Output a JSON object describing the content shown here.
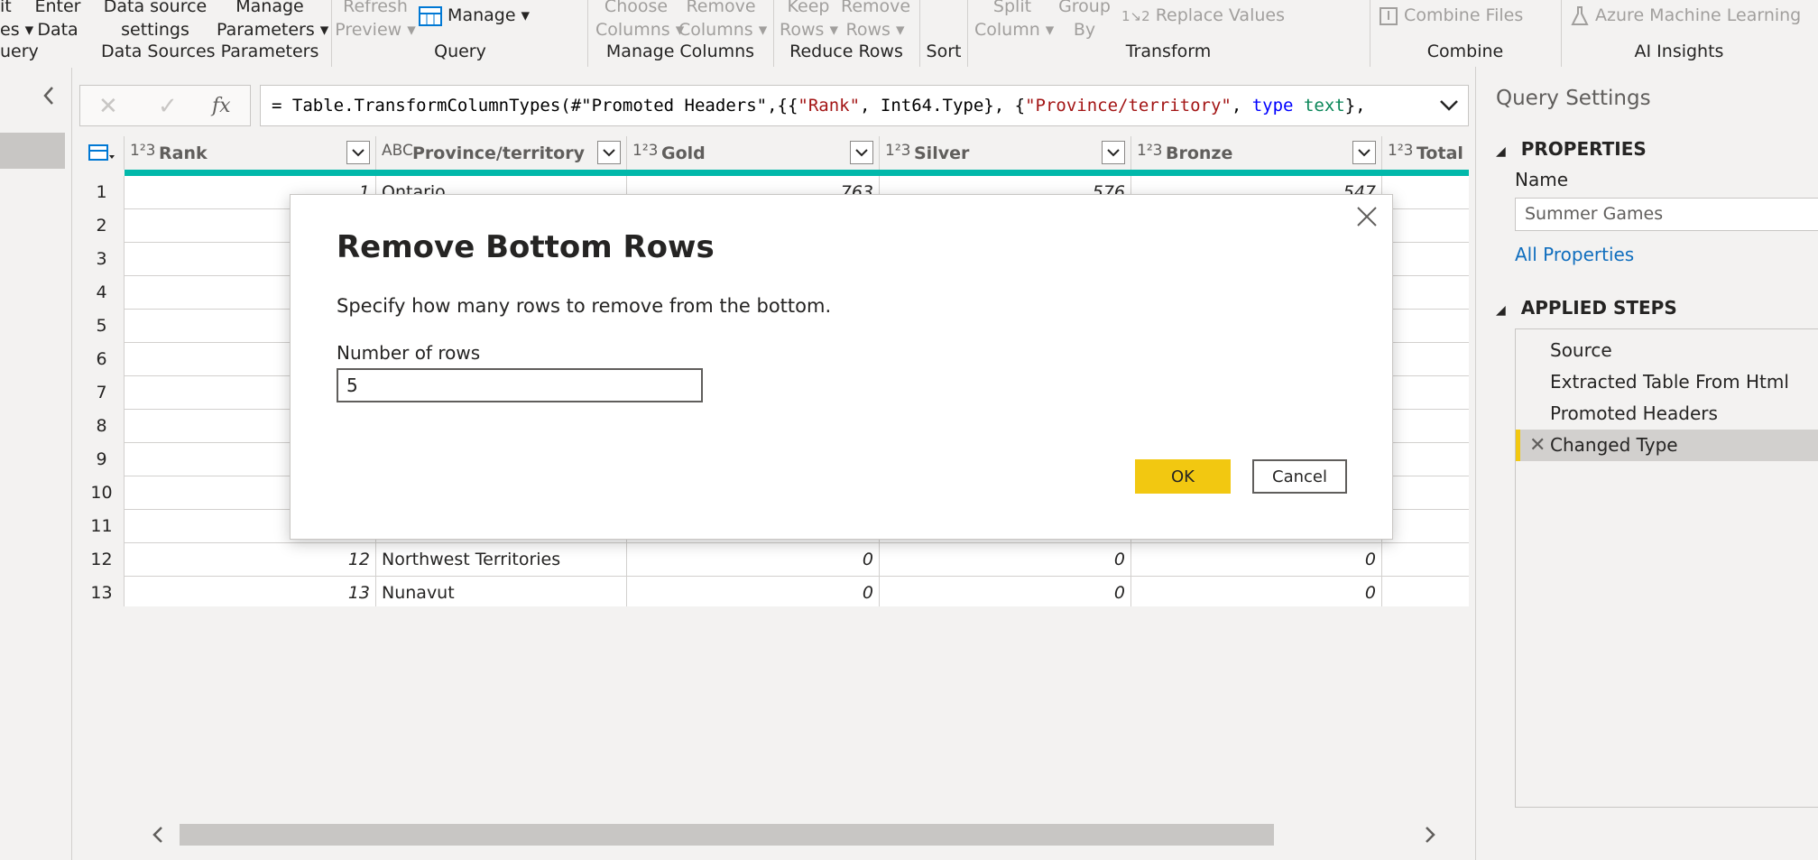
{
  "ribbon": {
    "buttons": {
      "recent_sources": "it\nes ▾",
      "enter_data": "Enter\nData",
      "data_source_settings": "Data source\nsettings",
      "manage_parameters": "Manage\nParameters ▾",
      "refresh_preview": "Refresh\nPreview ▾",
      "manage": "Manage ▾",
      "choose_columns": "Choose\nColumns ▾",
      "remove_columns": "Remove\nColumns ▾",
      "keep_rows": "Keep\nRows ▾",
      "remove_rows": "Remove\nRows ▾",
      "split_column": "Split\nColumn ▾",
      "group_by": "Group\nBy",
      "replace_values": "Replace Values",
      "combine_files": "Combine Files",
      "azure_ml": "Azure Machine Learning"
    },
    "groups": {
      "query_left": "uery",
      "data_sources": "Data Sources",
      "parameters": "Parameters",
      "query": "Query",
      "manage_columns": "Manage Columns",
      "reduce_rows": "Reduce Rows",
      "sort": "Sort",
      "transform": "Transform",
      "combine": "Combine",
      "ai_insights": "AI Insights"
    }
  },
  "formula_bar": {
    "cancel_glyph": "✕",
    "commit_glyph": "✓",
    "fx_glyph": "fx",
    "parts": {
      "p1": "= Table.TransformColumnTypes(#\"Promoted Headers\",{{",
      "p2": "\"Rank\"",
      "p3": ", Int64.Type}, {",
      "p4": "\"Province/territory\"",
      "p5": ", ",
      "p6": "type",
      "p7": " ",
      "p8": "text",
      "p9": "},"
    }
  },
  "grid": {
    "columns": [
      {
        "type": "1²3",
        "name": "Rank"
      },
      {
        "type": "ABC",
        "name": "Province/territory"
      },
      {
        "type": "1²3",
        "name": "Gold"
      },
      {
        "type": "1²3",
        "name": "Silver"
      },
      {
        "type": "1²3",
        "name": "Bronze"
      },
      {
        "type": "1²3",
        "name": "Total"
      }
    ],
    "rows": [
      {
        "idx": "1",
        "rank": "1",
        "province": "Ontario",
        "gold": "763",
        "silver": "576",
        "bronze": "547"
      },
      {
        "idx": "2"
      },
      {
        "idx": "3"
      },
      {
        "idx": "4"
      },
      {
        "idx": "5"
      },
      {
        "idx": "6"
      },
      {
        "idx": "7"
      },
      {
        "idx": "8"
      },
      {
        "idx": "9"
      },
      {
        "idx": "10"
      },
      {
        "idx": "11"
      },
      {
        "idx": "12",
        "rank": "12",
        "province": "Northwest Territories",
        "gold": "0",
        "silver": "0",
        "bronze": "0"
      },
      {
        "idx": "13",
        "rank": "13",
        "province": "Nunavut",
        "gold": "0",
        "silver": "0",
        "bronze": "0"
      }
    ]
  },
  "query_settings": {
    "title": "Query Settings",
    "properties_heading": "PROPERTIES",
    "name_label": "Name",
    "name_value": "Summer Games",
    "all_properties": "All Properties",
    "applied_steps_heading": "APPLIED STEPS",
    "steps": [
      "Source",
      "Extracted Table From Html",
      "Promoted Headers",
      "Changed Type"
    ]
  },
  "dialog": {
    "title": "Remove Bottom Rows",
    "description": "Specify how many rows to remove from the bottom.",
    "field_label": "Number of rows",
    "field_value": "5",
    "ok_label": "OK",
    "cancel_label": "Cancel"
  },
  "colors": {
    "accent_yellow": "#f2c811",
    "teal_bar": "#01b8aa",
    "link_blue": "#106ebe"
  }
}
